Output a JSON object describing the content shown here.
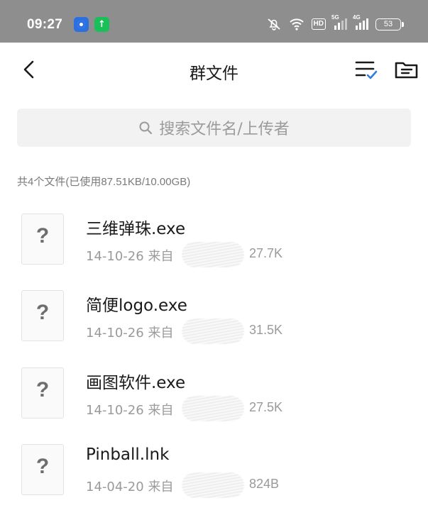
{
  "status_bar": {
    "time": "09:27",
    "hd_label": "HD",
    "net1": "5G",
    "net2": "4G",
    "battery": "53"
  },
  "header": {
    "title": "群文件"
  },
  "search": {
    "placeholder": "搜索文件名/上传者"
  },
  "summary": "共4个文件(已使用87.51KB/10.00GB)",
  "files": [
    {
      "name": "三维弹珠.exe",
      "date": "14-10-26",
      "from": "来自",
      "size": "27.7K",
      "icon": "?"
    },
    {
      "name": "简便logo.exe",
      "date": "14-10-26",
      "from": "来自",
      "size": "31.5K",
      "icon": "?"
    },
    {
      "name": "画图软件.exe",
      "date": "14-10-26",
      "from": "来自",
      "size": "27.5K",
      "icon": "?"
    },
    {
      "name": "Pinball.lnk",
      "date": "14-04-20",
      "from": "来自",
      "size": "824B",
      "icon": "?"
    }
  ]
}
